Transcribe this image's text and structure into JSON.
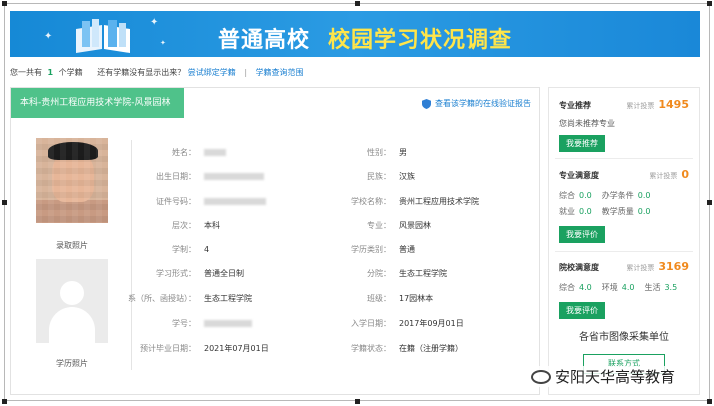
{
  "banner": {
    "title_white": "普通高校",
    "title_yellow": "校园学习状况调查"
  },
  "summary": {
    "prefix": "您一共有",
    "count": "1",
    "unit": "个学籍",
    "question": "还有学籍没有显示出来？",
    "bind_link": "尝试绑定学籍",
    "separator": "|",
    "scope_link": "学籍查询范围"
  },
  "tab": {
    "title": "本科-贵州工程应用技术学院-风景园林",
    "verify_link": "查看该学籍的在线验证报告"
  },
  "photos": {
    "enroll_caption": "录取照片",
    "degree_caption": "学历照片"
  },
  "fields_left": [
    {
      "label": "姓名：",
      "value": ""
    },
    {
      "label": "出生日期：",
      "value": ""
    },
    {
      "label": "证件号码：",
      "value": ""
    },
    {
      "label": "层次：",
      "value": "本科"
    },
    {
      "label": "学制：",
      "value": "4"
    },
    {
      "label": "学习形式：",
      "value": "普通全日制"
    },
    {
      "label": "系（所、函授站）：",
      "value": "生态工程学院"
    },
    {
      "label": "学号：",
      "value": ""
    },
    {
      "label": "预计毕业日期：",
      "value": "2021年07月01日"
    }
  ],
  "fields_right": [
    {
      "label": "性别：",
      "value": "男"
    },
    {
      "label": "民族：",
      "value": "汉族"
    },
    {
      "label": "学校名称：",
      "value": "贵州工程应用技术学院"
    },
    {
      "label": "专业：",
      "value": "风景园林"
    },
    {
      "label": "学历类别：",
      "value": "普通"
    },
    {
      "label": "分院：",
      "value": "生态工程学院"
    },
    {
      "label": "班级：",
      "value": "17园林本"
    },
    {
      "label": "入学日期：",
      "value": "2017年09月01日"
    },
    {
      "label": "学籍状态：",
      "value": "在籍（注册学籍）"
    }
  ],
  "sidebar": {
    "recommend": {
      "title": "专业推荐",
      "vote_label": "累计投票",
      "votes": "1495",
      "note": "您尚未推荐专业",
      "button": "我要推荐"
    },
    "major_sat": {
      "title": "专业满意度",
      "vote_label": "累计投票",
      "votes": "0",
      "m1_label": "综合",
      "m1_value": "0.0",
      "m2_label": "办学条件",
      "m2_value": "0.0",
      "m3_label": "就业",
      "m3_value": "0.0",
      "m4_label": "教学质量",
      "m4_value": "0.0",
      "button": "我要评价"
    },
    "school_sat": {
      "title": "院校满意度",
      "vote_label": "累计投票",
      "votes": "3169",
      "m1_label": "综合",
      "m1_value": "4.0",
      "m2_label": "环境",
      "m2_value": "4.0",
      "m3_label": "生活",
      "m3_value": "3.5",
      "button": "我要评价"
    },
    "gather_title": "各省市图像采集单位",
    "contact_button": "联系方式"
  },
  "watermark": {
    "text": "安阳天华高等教育"
  },
  "colors": {
    "banner_blue": "#1a8ad8",
    "accent_green": "#1aa160",
    "tab_green": "#4fc28a",
    "votes_orange": "#f08a1e",
    "link_blue": "#1a7fd0"
  }
}
